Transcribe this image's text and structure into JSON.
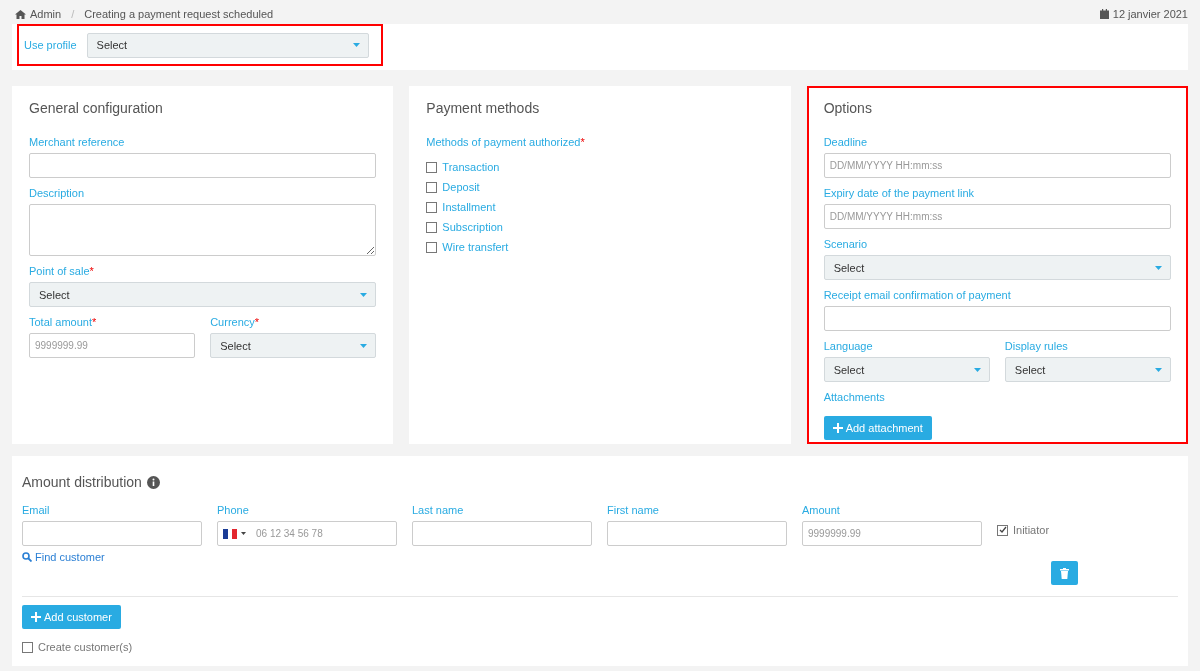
{
  "breadcrumb": {
    "items": [
      "Admin",
      "Creating a payment request scheduled"
    ],
    "separator": "/",
    "date": "12 janvier 2021"
  },
  "profile": {
    "highlighted": true,
    "label": "Use profile",
    "value": "Select"
  },
  "panels": [
    {
      "title": "General configuration",
      "highlighted": false,
      "rows": [
        [
          {
            "kind": "text",
            "label": "Merchant reference"
          }
        ],
        [
          {
            "kind": "textarea",
            "label": "Description"
          }
        ],
        [
          {
            "kind": "select",
            "label": "Point of sale",
            "mark": "*",
            "value": "Select"
          }
        ],
        [
          {
            "kind": "text",
            "label": "Total amount",
            "mark": "*",
            "placeholder": "9999999.99"
          },
          {
            "kind": "select",
            "label": "Currency",
            "mark": "*",
            "value": "Select"
          }
        ]
      ]
    },
    {
      "title": "Payment methods",
      "highlighted": false,
      "rows": [
        [
          {
            "kind": "checklist",
            "label": "Methods of payment authorized",
            "mark": "*",
            "options": [
              {
                "label": "Transaction",
                "checked": false
              },
              {
                "label": "Deposit",
                "checked": false
              },
              {
                "label": "Installment",
                "checked": false
              },
              {
                "label": "Subscription",
                "checked": false
              },
              {
                "label": "Wire transfert",
                "checked": false
              }
            ]
          }
        ]
      ]
    },
    {
      "title": "Options",
      "highlighted": true,
      "rows": [
        [
          {
            "kind": "text",
            "label": "Deadline",
            "placeholder": "DD/MM/YYYY HH:mm:ss"
          }
        ],
        [
          {
            "kind": "text",
            "label": "Expiry date of the payment link",
            "placeholder": "DD/MM/YYYY HH:mm:ss"
          }
        ],
        [
          {
            "kind": "select",
            "label": "Scenario",
            "value": "Select"
          }
        ],
        [
          {
            "kind": "text",
            "label": "Receipt email confirmation of payment"
          }
        ],
        [
          {
            "kind": "select",
            "label": "Language",
            "value": "Select"
          },
          {
            "kind": "select",
            "label": "Display rules",
            "value": "Select"
          }
        ],
        [
          {
            "kind": "button",
            "label": "Attachments",
            "button": "Add attachment"
          }
        ]
      ]
    }
  ],
  "distribution": {
    "title": "Amount distribution",
    "customer": {
      "email": {
        "label": "Email",
        "link": "Find customer"
      },
      "phone": {
        "label": "Phone",
        "placeholder": "06 12 34 56 78"
      },
      "last_name": {
        "label": "Last name"
      },
      "first_name": {
        "label": "First name"
      },
      "amount": {
        "label": "Amount",
        "placeholder": "9999999.99"
      },
      "initiator": {
        "label": "Initiator",
        "checked": true
      }
    },
    "add_button": "Add customer",
    "create": {
      "label": "Create customer(s)",
      "checked": false
    }
  }
}
